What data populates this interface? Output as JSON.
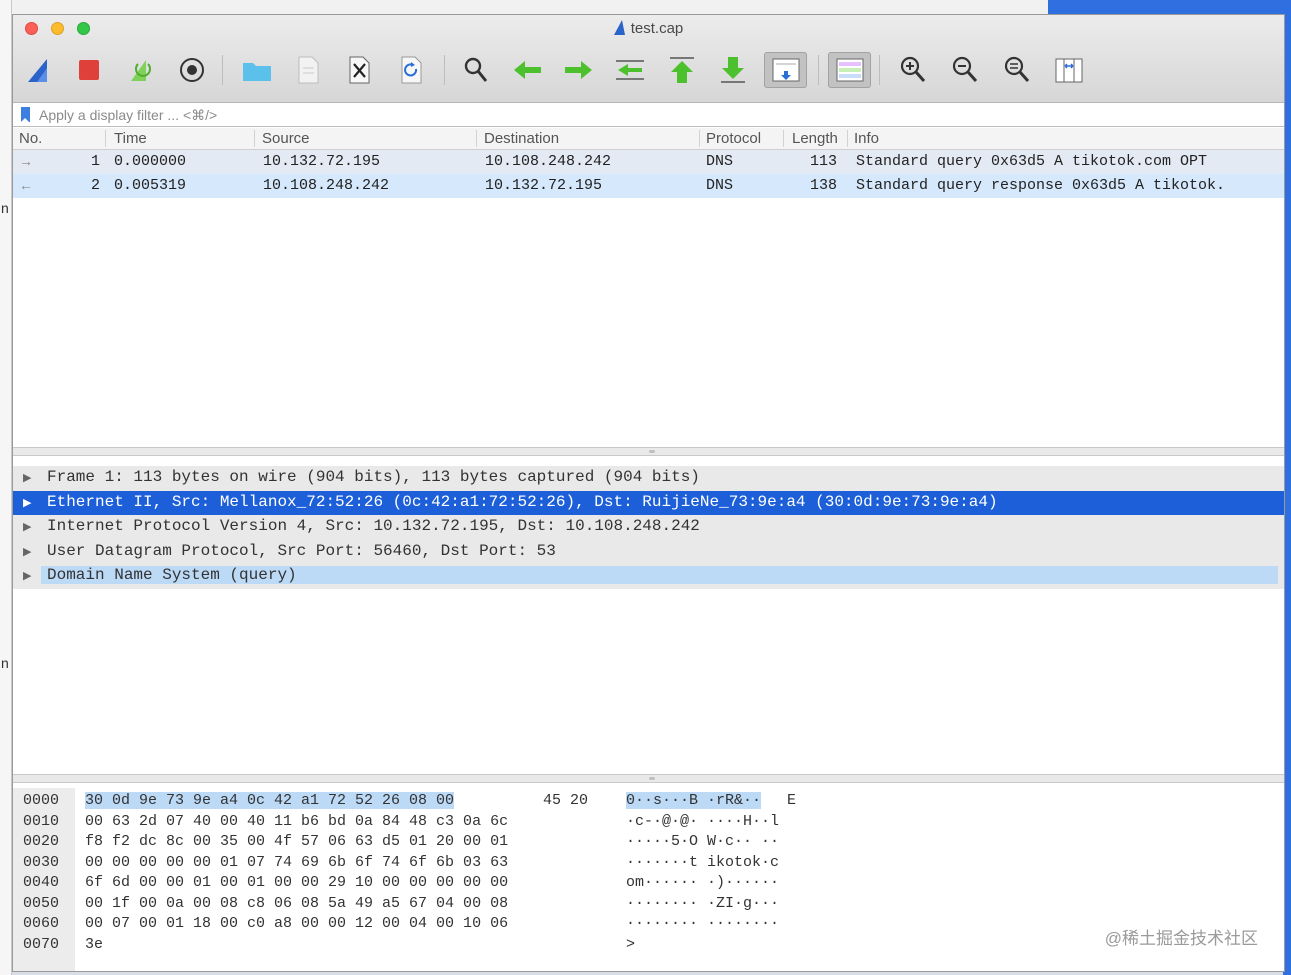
{
  "window": {
    "title": "test.cap"
  },
  "filter": {
    "placeholder": "Apply a display filter ... <⌘/>"
  },
  "columns": [
    "No.",
    "Time",
    "Source",
    "Destination",
    "Protocol",
    "Length",
    "Info"
  ],
  "packets": [
    {
      "no": "1",
      "time": "0.000000",
      "source": "10.132.72.195",
      "destination": "10.108.248.242",
      "protocol": "DNS",
      "length": "113",
      "info": "Standard query 0x63d5 A tikotok.com OPT"
    },
    {
      "no": "2",
      "time": "0.005319",
      "source": "10.108.248.242",
      "destination": "10.132.72.195",
      "protocol": "DNS",
      "length": "138",
      "info": "Standard query response 0x63d5 A tikotok."
    }
  ],
  "details": [
    "Frame 1: 113 bytes on wire (904 bits), 113 bytes captured (904 bits)",
    "Ethernet II, Src: Mellanox_72:52:26 (0c:42:a1:72:52:26), Dst: RuijieNe_73:9e:a4 (30:0d:9e:73:9e:a4)",
    "Internet Protocol Version 4, Src: 10.132.72.195, Dst: 10.108.248.242",
    "User Datagram Protocol, Src Port: 56460, Dst Port: 53",
    "Domain Name System (query)"
  ],
  "bytes": [
    {
      "offset": "0000",
      "hex_sel": "30 0d 9e 73 9e a4 0c 42  a1 72 52 26 08 00",
      "hex_rest": "45 20",
      "ascii_sel": "0··s···B ·rR&··",
      "ascii_rest": "E"
    },
    {
      "offset": "0010",
      "hex": "00 63 2d 07 40 00 40 11  b6 bd 0a 84 48 c3 0a 6c",
      "ascii": "·c-·@·@·  ····H··l"
    },
    {
      "offset": "0020",
      "hex": "f8 f2 dc 8c 00 35 00 4f  57 06 63 d5 01 20 00 01",
      "ascii": "·····5·O W·c·· ··"
    },
    {
      "offset": "0030",
      "hex": "00 00 00 00 00 01 07 74  69 6b 6f 74 6f 6b 03 63",
      "ascii": "·······t ikotok·c"
    },
    {
      "offset": "0040",
      "hex": "6f 6d 00 00 01 00 01 00  00 29 10 00 00 00 00 00",
      "ascii": "om······ ·)······"
    },
    {
      "offset": "0050",
      "hex": "00 1f 00 0a 00 08 c8 06  08 5a 49 a5 67 04 00 08",
      "ascii": "········ ·ZI·g···"
    },
    {
      "offset": "0060",
      "hex": "00 07 00 01 18 00 c0 a8  00 00 12 00 04 00 10 06",
      "ascii": "········ ········"
    },
    {
      "offset": "0070",
      "hex": "3e",
      "ascii": ">"
    }
  ],
  "watermark": "@稀土掘金技术社区",
  "colors": {
    "selection": "#1c5fd8",
    "highlight": "#bcd9f6",
    "accent": "#2a63c9"
  }
}
